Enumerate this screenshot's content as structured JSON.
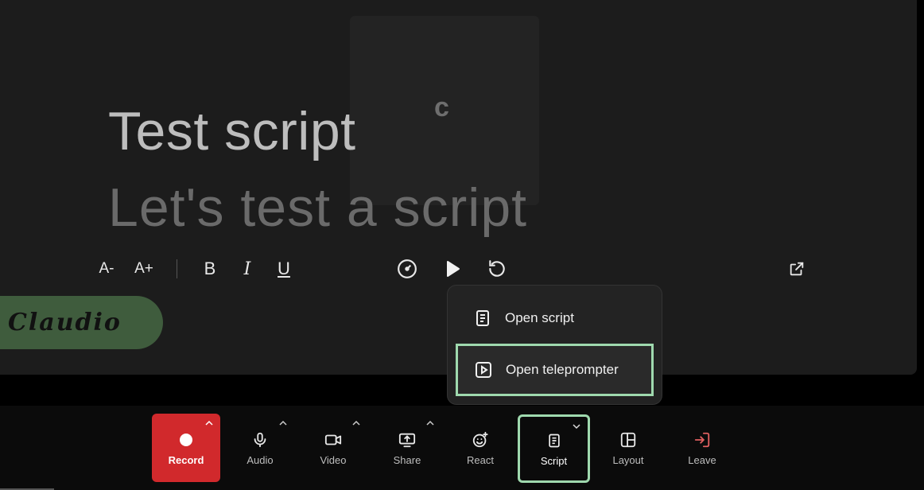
{
  "stage": {
    "avatar_initial": "c",
    "script_title": "Test script",
    "script_body": "Let's test a script"
  },
  "teleprompter_toolbar": {
    "decrease_font_label": "A-",
    "increase_font_label": "A+",
    "bold_label": "B",
    "italic_label": "I",
    "underline_label": "U",
    "icons": [
      "speed-icon",
      "play-icon",
      "reset-icon",
      "external-link-icon"
    ]
  },
  "name_tag": {
    "name": "Claudio"
  },
  "script_menu": {
    "items": [
      {
        "label": "Open script",
        "icon": "document-icon"
      },
      {
        "label": "Open teleprompter",
        "icon": "play-square-icon",
        "selected": true
      }
    ]
  },
  "controls": {
    "record": "Record",
    "audio": "Audio",
    "video": "Video",
    "share": "Share",
    "react": "React",
    "script": "Script",
    "layout": "Layout",
    "leave": "Leave"
  },
  "colors": {
    "record": "#d1292c",
    "highlight": "#9fd9ae",
    "name_tag": "#3f5c3d",
    "leave_icon": "#e06060"
  }
}
